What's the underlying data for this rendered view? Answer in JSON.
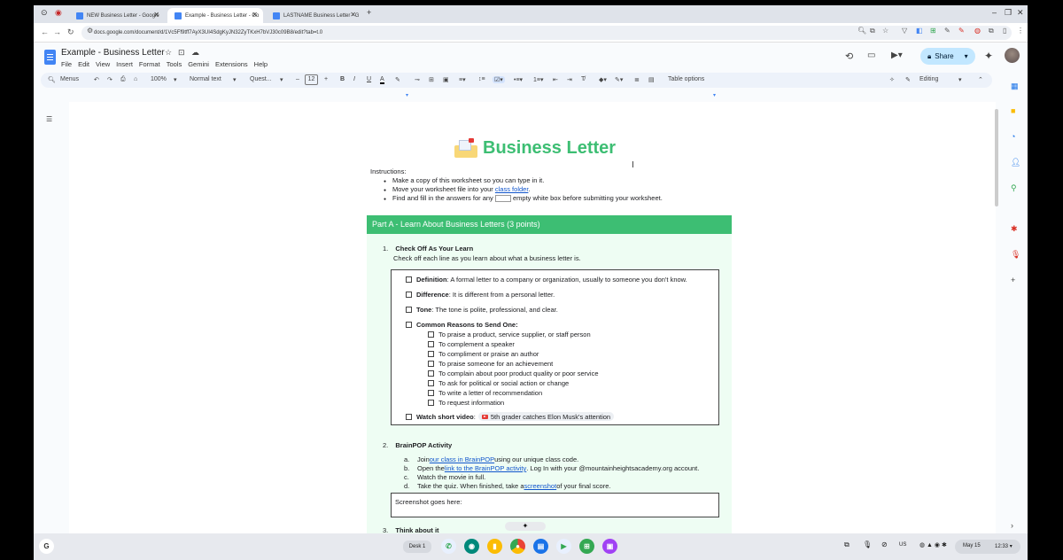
{
  "browser": {
    "tabs": [
      {
        "label": "NEW Business Letter - Google",
        "active": false
      },
      {
        "label": "Example - Business Letter - Go",
        "active": true
      },
      {
        "label": "LASTNAME Business Letter - G",
        "active": false
      }
    ],
    "url": "docs.google.com/document/d/1Vc5Ff9tff7AyX3UI4SdgKyJN32ZyTKxH7bVJ30c09B8/edit?tab=t.0"
  },
  "docs": {
    "title": "Example - Business Letter",
    "menus": [
      "File",
      "Edit",
      "View",
      "Insert",
      "Format",
      "Tools",
      "Gemini",
      "Extensions",
      "Help"
    ],
    "share_label": "Share",
    "toolbar": {
      "menus_label": "Menus",
      "zoom": "100%",
      "style": "Normal text",
      "font": "Quest...",
      "font_size": "12",
      "table_options": "Table options",
      "mode": "Editing"
    }
  },
  "document": {
    "title": "Business Letter",
    "instructions_label": "Instructions:",
    "instructions": {
      "i1": "Make a copy of this worksheet so you can type in it.",
      "i2_pre": "Move your worksheet file into your ",
      "i2_link": "class folder",
      "i2_post": ".",
      "i3_pre": "Find and fill in the answers for any ",
      "i3_post": " empty white box before submitting your worksheet."
    },
    "partA": "Part A -  Learn About Business Letters (3 points)",
    "item1": {
      "num": "1.",
      "title": "Check Off As Your Learn",
      "desc": "Check off each line as you learn about what a business letter is."
    },
    "checklist": {
      "definition_b": "Definition",
      "definition": ": A formal letter to a company or organization, usually to someone you don't know.",
      "difference_b": "Difference",
      "difference": ": It is different from a personal letter.",
      "tone_b": "Tone",
      "tone": ": The tone is polite, professional, and clear.",
      "reasons_b": "Common Reasons to Send One:",
      "reasons": [
        "To praise a product, service supplier, or staff person",
        "To complement a speaker",
        "To compliment or praise an author",
        "To praise someone for an achievement",
        "To complain about poor product quality or poor service",
        "To ask for political or social action or change",
        "To write a letter of recommendation",
        "To request information"
      ],
      "watch_b": "Watch short video",
      "watch_sep": " :",
      "video": "5th grader catches Elon Musk's attention"
    },
    "item2": {
      "num": "2.",
      "title": "BrainPOP Activity",
      "a_l": "a.",
      "a_pre": "Join ",
      "a_link": "our class in BrainPOP",
      "a_post": " using our unique class code.",
      "b_l": "b.",
      "b_pre": "Open the ",
      "b_link": "link to the BrainPOP activity",
      "b_post": ". Log In with your @mountainheightsacademy.org account.",
      "c_l": "c.",
      "c": "Watch the movie in full.",
      "d_l": "d.",
      "d_pre": "Take the quiz. When finished, take a ",
      "d_link": "screenshot",
      "d_post": " of your final score."
    },
    "screenshot_label": "Screenshot goes here:",
    "item3": {
      "num": "3.",
      "title": "Think about it"
    }
  },
  "taskbar": {
    "desk": "Desk 1",
    "lang": "US",
    "date": "May 15",
    "time": "12:33"
  },
  "colors": {
    "accent_green": "#3dbe73",
    "mint_bg": "#eefdf3",
    "share_bg": "#c2e7ff"
  }
}
